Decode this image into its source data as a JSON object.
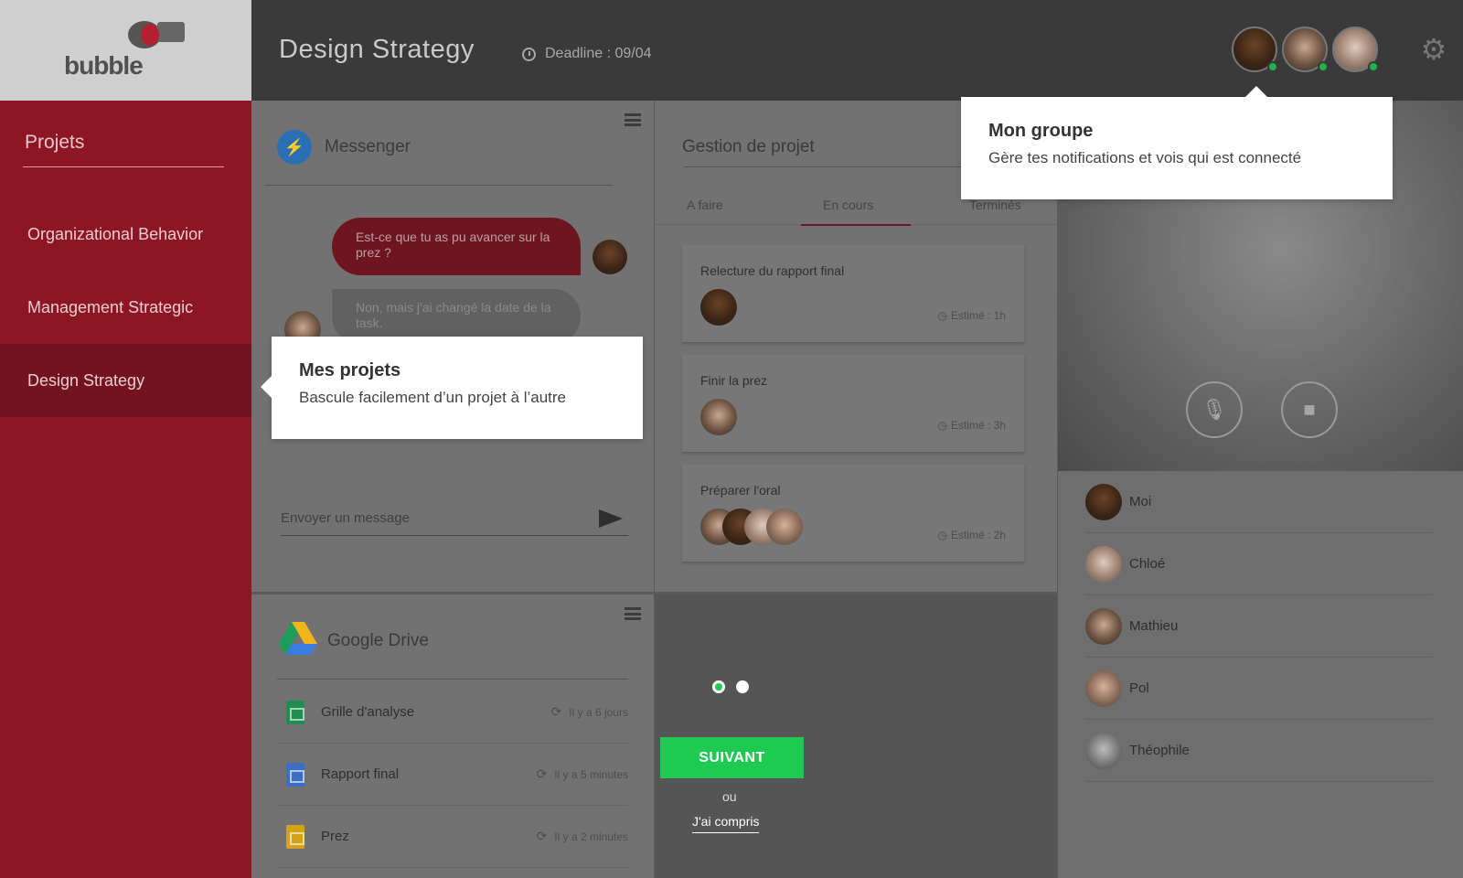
{
  "app": {
    "logo_text": "bubble"
  },
  "header": {
    "title": "Design Strategy",
    "deadline": "Deadline : 09/04",
    "group_avatars": [
      "Moi",
      "Mathieu",
      "Chloé"
    ]
  },
  "sidebar": {
    "title": "Projets",
    "items": [
      {
        "label": "Organizational Behavior"
      },
      {
        "label": "Management Strategic"
      },
      {
        "label": "Design Strategy",
        "active": true
      }
    ]
  },
  "messenger": {
    "title": "Messenger",
    "messages": [
      {
        "text": "Est-ce que tu as pu avancer sur la prez ?",
        "from": "me"
      },
      {
        "text": "Non, mais j'ai changé la date de la task.",
        "from": "other"
      }
    ],
    "input_placeholder": "Envoyer un message"
  },
  "drive": {
    "title": "Google Drive",
    "files": [
      {
        "name": "Grille d'analyse",
        "meta": "Il y a 6 jours",
        "color": "#1e8f4e"
      },
      {
        "name": "Rapport final",
        "meta": "Il y a 5 minutes",
        "color": "#3b6fc4"
      },
      {
        "name": "Prez",
        "meta": "Il y a 2 minutes",
        "color": "#d4a21b"
      }
    ]
  },
  "gestion": {
    "title": "Gestion de projet",
    "tabs": [
      "A faire",
      "En cours",
      "Terminés"
    ],
    "active_tab": "En cours",
    "tasks": [
      {
        "title": "Relecture du rapport final",
        "estimate": "Estimé : 1h"
      },
      {
        "title": "Finir la prez",
        "estimate": "Estimé : 3h"
      },
      {
        "title": "Préparer l'oral",
        "estimate": "Estimé : 2h"
      }
    ]
  },
  "members": [
    {
      "name": "Moi"
    },
    {
      "name": "Chloé"
    },
    {
      "name": "Mathieu"
    },
    {
      "name": "Pol"
    },
    {
      "name": "Théophile"
    }
  ],
  "onboarding": {
    "next_label": "SUIVANT",
    "or_label": "ou",
    "dismiss_label": "J'ai compris",
    "step": 1,
    "total_steps": 2
  },
  "tooltips": {
    "projets": {
      "title": "Mes projets",
      "body": "Bascule facilement d’un projet à l’autre"
    },
    "groupe": {
      "title": "Mon groupe",
      "body": "Gère tes notifications et vois qui est connecté"
    }
  },
  "colors": {
    "brand_red": "#8d1624",
    "accent_green": "#1fca53",
    "online": "#1fb34a"
  }
}
